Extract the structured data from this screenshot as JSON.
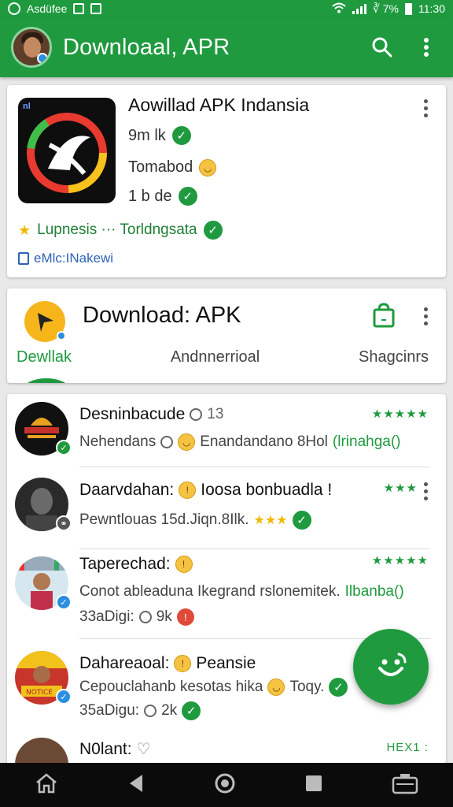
{
  "status_bar": {
    "left_label": "Asdüfee",
    "right_label": "∛ 7%",
    "time": "11:30"
  },
  "app_bar": {
    "title": "Downloaal, APR",
    "icons": [
      "profile-avatar",
      "search-icon",
      "more-vert-icon"
    ]
  },
  "featured_app": {
    "icon_tag": "nl",
    "title": "Aowillad APK Indansia",
    "line1": "9m lk",
    "line2": "Tomabod",
    "line3": "1 b de",
    "rating_text": "Lupnesis ··· Torldngsata",
    "info_text": "eMlc:INakewi"
  },
  "card2": {
    "title": "Download: APK",
    "tabs": [
      "Dewllak",
      "Andnnerrioal",
      "Shagcinrs"
    ]
  },
  "list": [
    {
      "name": "Desninbacude",
      "name_extra": "13",
      "sub_left": "Nehendans",
      "sub_mid": "Enandandano 8Hol",
      "sub_link": "(lrinahga()",
      "stars": "★★★★★"
    },
    {
      "name": "Daarvdahan:",
      "name_extra": "Ioosa bonbuadla !",
      "sub_left": "Pewntlouas 15d.Jiqn.8Ilk.",
      "stars": "★★★"
    },
    {
      "name": "Taperechad:",
      "sub_left": "Conot ableaduna Ikegrand rslonemitek.",
      "sub_link": "Ilbanba()",
      "meta_left": "33aDigi:",
      "meta_right": "9k",
      "stars": "★★★★★"
    },
    {
      "name": "Dahareaoal:",
      "name_extra": "Peansie",
      "sub_left": "Cepouclahanb kesotas hika",
      "sub_mid": "Toqy.",
      "meta_left": "35aDigu:",
      "meta_right": "2k"
    },
    {
      "name": "N0lant:",
      "stars": "HEX1 :"
    }
  ],
  "colors": {
    "primary": "#1f9a3f",
    "accent_yellow": "#f7b51c",
    "link_blue": "#2e63b8"
  }
}
